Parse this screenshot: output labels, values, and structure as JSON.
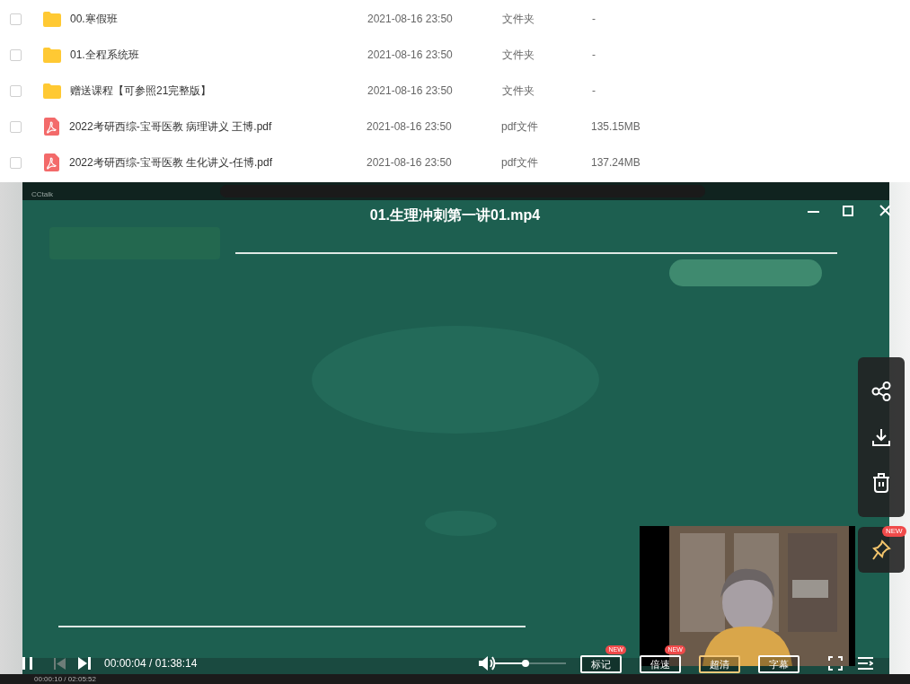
{
  "files": [
    {
      "kind": "folder",
      "checked": false,
      "name": "00.寒假班",
      "date": "2021-08-16 23:50",
      "type": "文件夹",
      "size": "-"
    },
    {
      "kind": "folder",
      "checked": false,
      "name": "01.全程系统班",
      "date": "2021-08-16 23:50",
      "type": "文件夹",
      "size": "-"
    },
    {
      "kind": "folder",
      "checked": false,
      "name": "赠送课程【可参照21完整版】",
      "date": "2021-08-16 23:50",
      "type": "文件夹",
      "size": "-"
    },
    {
      "kind": "pdf",
      "checked": false,
      "name": "2022考研西综-宝哥医教 病理讲义 王博.pdf",
      "date": "2021-08-16 23:50",
      "type": "pdf文件",
      "size": "135.15MB"
    },
    {
      "kind": "pdf",
      "checked": false,
      "name": "2022考研西综-宝哥医教 生化讲义-任博.pdf",
      "date": "2021-08-16 23:50",
      "type": "pdf文件",
      "size": "137.24MB"
    }
  ],
  "player": {
    "app": "CCtalk",
    "title": "01.生理冲刺第一讲01.mp4",
    "pin_badge": "NEW",
    "time": "00:00:04 / 01:38:14",
    "volume": {
      "level": 0.43
    },
    "buttons": [
      {
        "label": "标记",
        "badge": "NEW",
        "highlight": false
      },
      {
        "label": "倍速",
        "badge": "NEW",
        "highlight": false
      },
      {
        "label": "超清",
        "highlight": true
      },
      {
        "label": "字幕",
        "highlight": false
      }
    ],
    "background_time": "00:00:10 / 02:05:52"
  }
}
